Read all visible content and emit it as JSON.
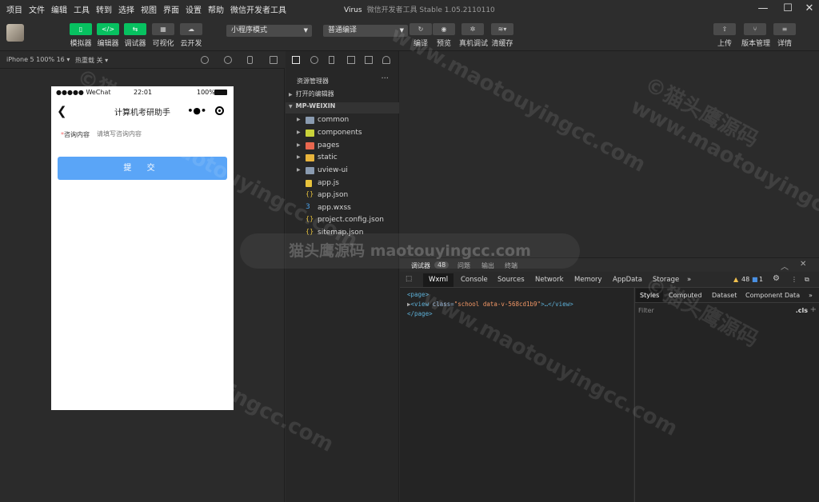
{
  "menubar": {
    "items": [
      "项目",
      "文件",
      "编辑",
      "工具",
      "转到",
      "选择",
      "视图",
      "界面",
      "设置",
      "帮助",
      "微信开发者工具"
    ],
    "title_app": "Virus",
    "title_tool": "微信开发者工具 Stable 1.05.2110110"
  },
  "toolbar": {
    "simulator": "模拟器",
    "editor": "编辑器",
    "debugger": "调试器",
    "visual": "可视化",
    "cloud": "云开发",
    "mode": "小程序模式",
    "compile_mode": "普通编译",
    "compile": "编译",
    "preview": "预览",
    "remote_debug": "真机调试",
    "clear_cache": "清缓存",
    "upload": "上传",
    "version": "版本管理",
    "details": "详情"
  },
  "simbar": {
    "device": "iPhone 5 100% 16 ▾",
    "hotreload": "热重载 关 ▾"
  },
  "phone": {
    "signal": "●●●●● WeChat",
    "time": "22:01",
    "battery": "100%",
    "nav_title": "计算机考研助手",
    "field_label": "咨询内容",
    "field_placeholder": "请填写咨询内容",
    "submit": "提 交"
  },
  "explorer": {
    "title": "资源管理器",
    "open_editors": "打开的编辑器",
    "project": "MP-WEIXIN",
    "files": [
      {
        "name": "common",
        "type": "folder",
        "color": "#8a9bb0"
      },
      {
        "name": "components",
        "type": "folder",
        "color": "#c9d23a"
      },
      {
        "name": "pages",
        "type": "folder",
        "color": "#e8674f"
      },
      {
        "name": "static",
        "type": "folder",
        "color": "#e8b43c"
      },
      {
        "name": "uview-ui",
        "type": "folder",
        "color": "#8a9bb0"
      },
      {
        "name": "app.js",
        "type": "file",
        "color": "#e8c33c"
      },
      {
        "name": "app.json",
        "type": "json",
        "color": "#e8c33c"
      },
      {
        "name": "app.wxss",
        "type": "css",
        "color": "#4aa0e8"
      },
      {
        "name": "project.config.json",
        "type": "json",
        "color": "#e8c33c"
      },
      {
        "name": "sitemap.json",
        "type": "json",
        "color": "#e8c33c"
      }
    ]
  },
  "debug": {
    "tab_debugger": "调试器",
    "count": "48",
    "tab_issues": "问题",
    "tab_output": "输出",
    "tab_terminal": "终端",
    "tabs": [
      "Wxml",
      "Console",
      "Sources",
      "Network",
      "Memory",
      "AppData",
      "Storage"
    ],
    "warn_count": "48",
    "info_count": "1",
    "dom": {
      "line1": "<page>",
      "line2_open": "<view",
      "line2_attr": " class=",
      "line2_val": "\"school data-v-568cd1b9\"",
      "line2_close": ">…</view>",
      "line3": "</page>"
    },
    "styles_tabs": [
      "Styles",
      "Computed",
      "Dataset",
      "Component Data"
    ],
    "filter": "Filter",
    "cls": ".cls"
  },
  "watermark": {
    "text_cn": "©猫头鹰源码",
    "text_en": "www.maotouyingcc.com",
    "center": "猫头鹰源码 maotouyingcc.com"
  },
  "colors": {
    "accent_green": "#07c160",
    "submit_blue": "#5aa5f7"
  }
}
